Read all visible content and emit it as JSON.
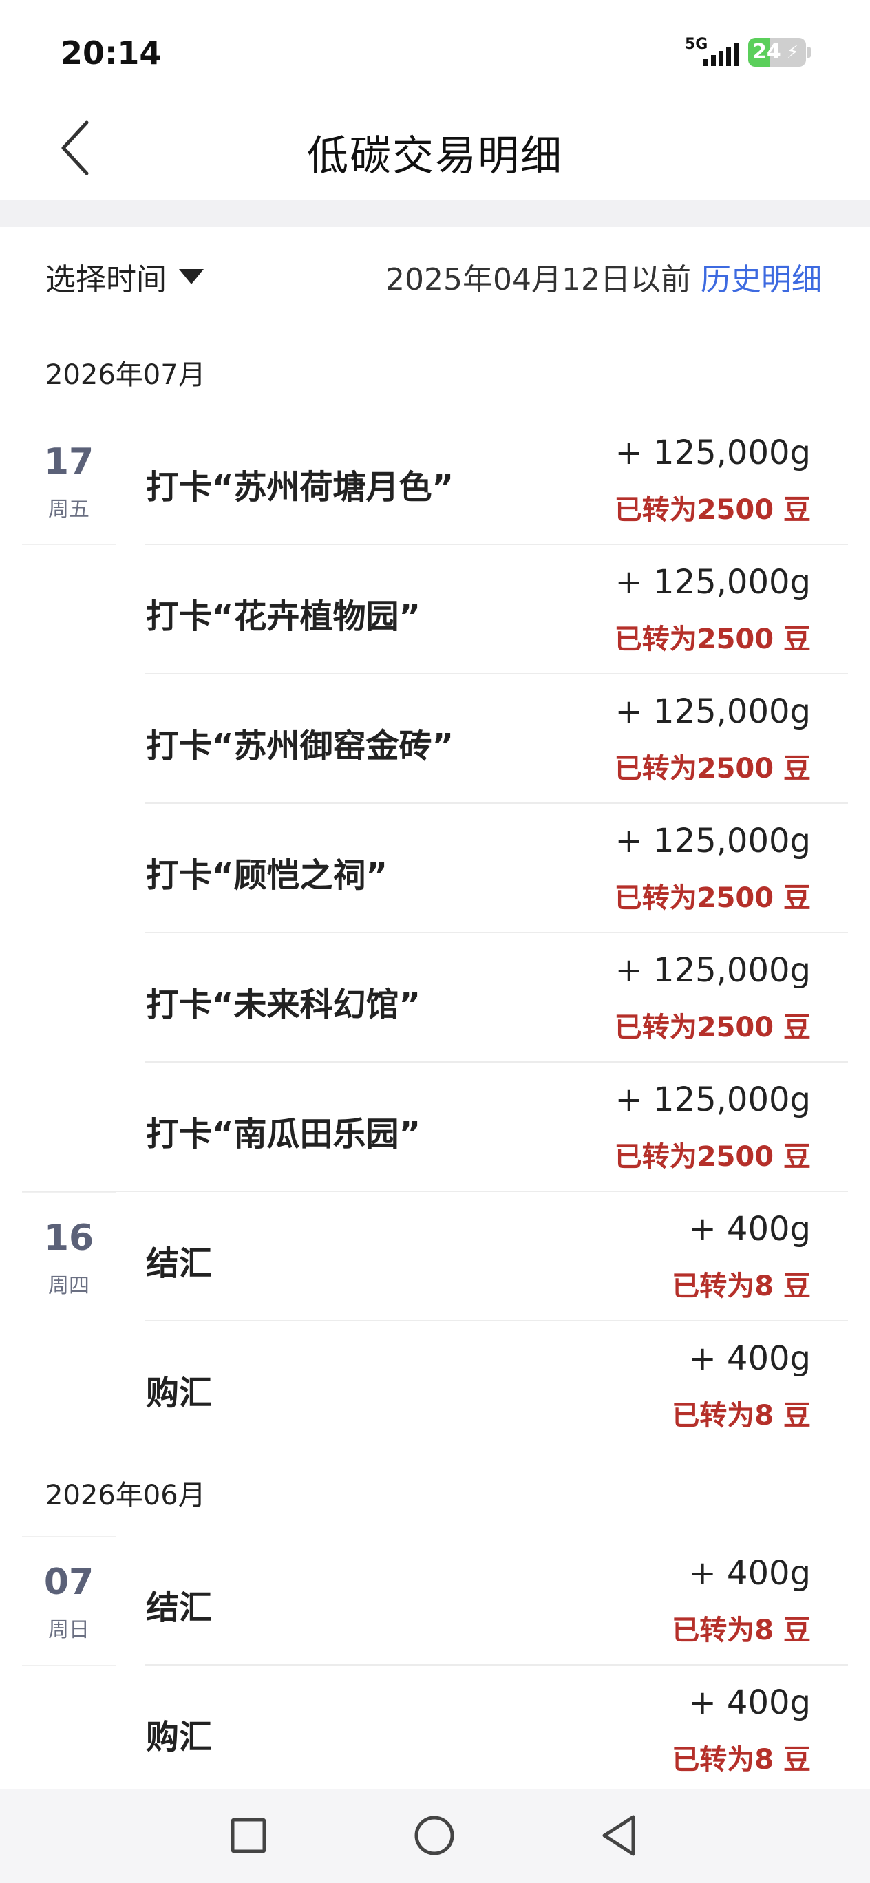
{
  "status_bar": {
    "time": "20:14",
    "network": "5G",
    "battery_percent": "24",
    "battery_level": 0.24
  },
  "header": {
    "title": "低碳交易明细"
  },
  "filter": {
    "select_time_label": "选择时间",
    "date_note": "2025年04月12日以前",
    "history_link": "历史明细"
  },
  "months": [
    {
      "label": "2026年07月",
      "days": [
        {
          "day": "17",
          "weekday": "周五",
          "items": [
            {
              "title": "打卡“苏州荷塘月色”",
              "amount": "+ 125,000g",
              "converted": "已转为2500 豆"
            },
            {
              "title": "打卡“花卉植物园”",
              "amount": "+ 125,000g",
              "converted": "已转为2500 豆"
            },
            {
              "title": "打卡“苏州御窑金砖”",
              "amount": "+ 125,000g",
              "converted": "已转为2500 豆"
            },
            {
              "title": "打卡“顾恺之祠”",
              "amount": "+ 125,000g",
              "converted": "已转为2500 豆"
            },
            {
              "title": "打卡“未来科幻馆”",
              "amount": "+ 125,000g",
              "converted": "已转为2500 豆"
            },
            {
              "title": "打卡“南瓜田乐园”",
              "amount": "+ 125,000g",
              "converted": "已转为2500 豆"
            }
          ]
        },
        {
          "day": "16",
          "weekday": "周四",
          "items": [
            {
              "title": "结汇",
              "amount": "+ 400g",
              "converted": "已转为8 豆"
            },
            {
              "title": "购汇",
              "amount": "+ 400g",
              "converted": "已转为8 豆"
            }
          ]
        }
      ]
    },
    {
      "label": "2026年06月",
      "days": [
        {
          "day": "07",
          "weekday": "周日",
          "items": [
            {
              "title": "结汇",
              "amount": "+ 400g",
              "converted": "已转为8 豆"
            },
            {
              "title": "购汇",
              "amount": "+ 400g",
              "converted": "已转为8 豆"
            }
          ]
        }
      ]
    }
  ],
  "colors": {
    "accent_blue": "#3d6ae0",
    "converted_red": "#b5302a",
    "day_gray": "#5b6178"
  }
}
